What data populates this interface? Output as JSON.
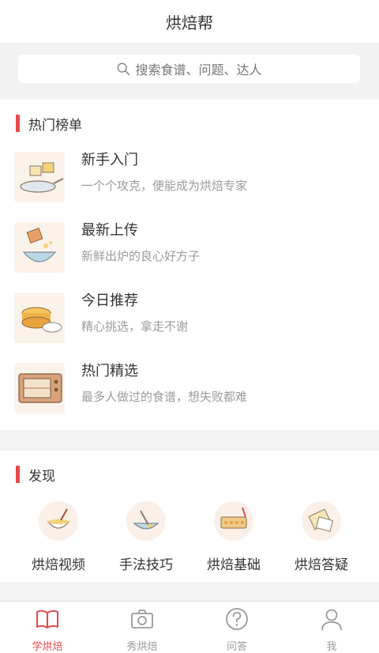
{
  "header": {
    "title": "烘焙帮"
  },
  "search": {
    "placeholder": "搜索食谱、问题、达人"
  },
  "hot": {
    "title": "热门榜单",
    "items": [
      {
        "name": "新手入门",
        "desc": "一个个攻克，便能成为烘焙专家",
        "icon": "baking-pan-icon"
      },
      {
        "name": "最新上传",
        "desc": "新鲜出炉的良心好方子",
        "icon": "mixing-bowl-icon"
      },
      {
        "name": "今日推荐",
        "desc": "精心挑选，拿走不谢",
        "icon": "cake-icon"
      },
      {
        "name": "热门精选",
        "desc": "最多人做过的食谱，想失败都难",
        "icon": "oven-icon"
      }
    ]
  },
  "discover": {
    "title": "发现",
    "items": [
      {
        "label": "烘焙视频",
        "icon": "video-bowl-icon"
      },
      {
        "label": "手法技巧",
        "icon": "whisk-icon"
      },
      {
        "label": "烘焙基础",
        "icon": "tray-icon"
      },
      {
        "label": "烘焙答疑",
        "icon": "question-icon"
      }
    ]
  },
  "tabbar": {
    "active": "学烘焙",
    "accent": "#e5484d",
    "items": [
      {
        "label": "学烘焙",
        "icon": "book-icon"
      },
      {
        "label": "秀烘焙",
        "icon": "camera-icon"
      },
      {
        "label": "问答",
        "icon": "question-circle-icon"
      },
      {
        "label": "我",
        "icon": "user-icon"
      }
    ]
  }
}
